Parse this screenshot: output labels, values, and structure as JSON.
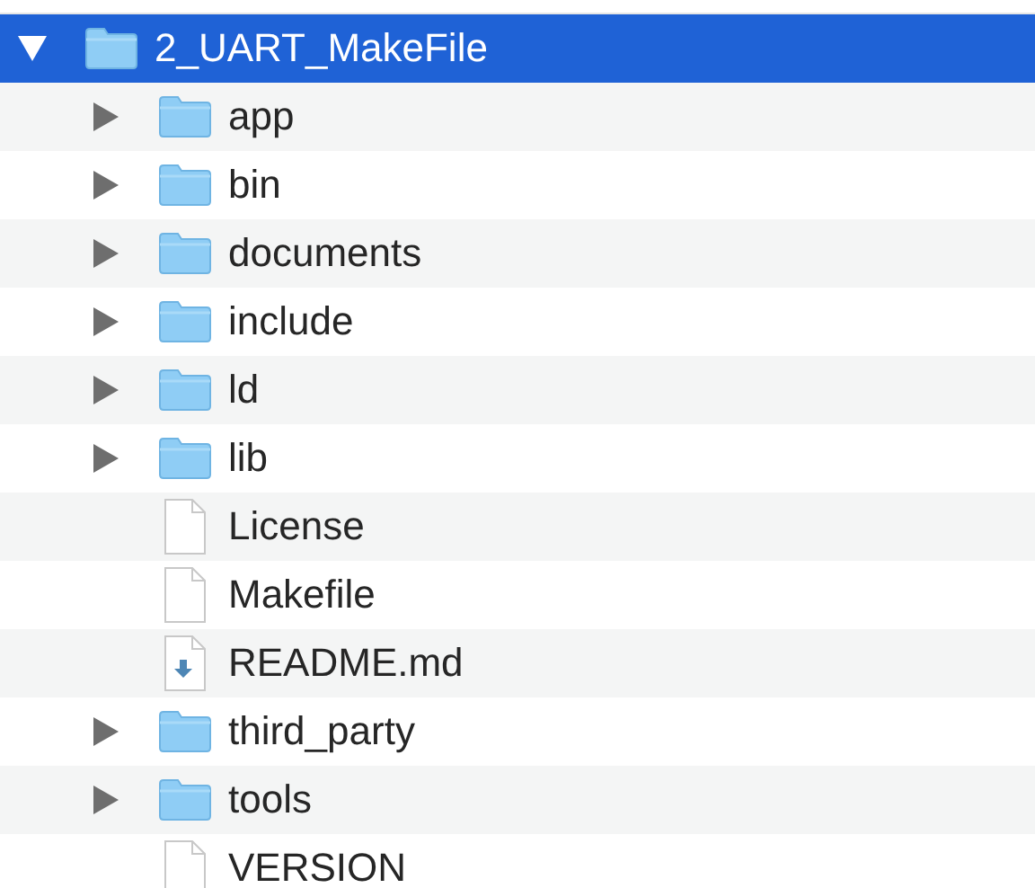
{
  "items": [
    {
      "name": "2_UART_MakeFile",
      "kind": "folder",
      "expanded": true,
      "selected": true,
      "children": [
        {
          "name": "app",
          "kind": "folder",
          "expanded": false,
          "selected": false
        },
        {
          "name": "bin",
          "kind": "folder",
          "expanded": false,
          "selected": false
        },
        {
          "name": "documents",
          "kind": "folder",
          "expanded": false,
          "selected": false
        },
        {
          "name": "include",
          "kind": "folder",
          "expanded": false,
          "selected": false
        },
        {
          "name": "ld",
          "kind": "folder",
          "expanded": false,
          "selected": false
        },
        {
          "name": "lib",
          "kind": "folder",
          "expanded": false,
          "selected": false
        },
        {
          "name": "License",
          "kind": "file",
          "selected": false
        },
        {
          "name": "Makefile",
          "kind": "file",
          "selected": false
        },
        {
          "name": "README.md",
          "kind": "markdown",
          "selected": false
        },
        {
          "name": "third_party",
          "kind": "folder",
          "expanded": false,
          "selected": false
        },
        {
          "name": "tools",
          "kind": "folder",
          "expanded": false,
          "selected": false
        },
        {
          "name": "VERSION",
          "kind": "file",
          "selected": false
        }
      ]
    }
  ]
}
